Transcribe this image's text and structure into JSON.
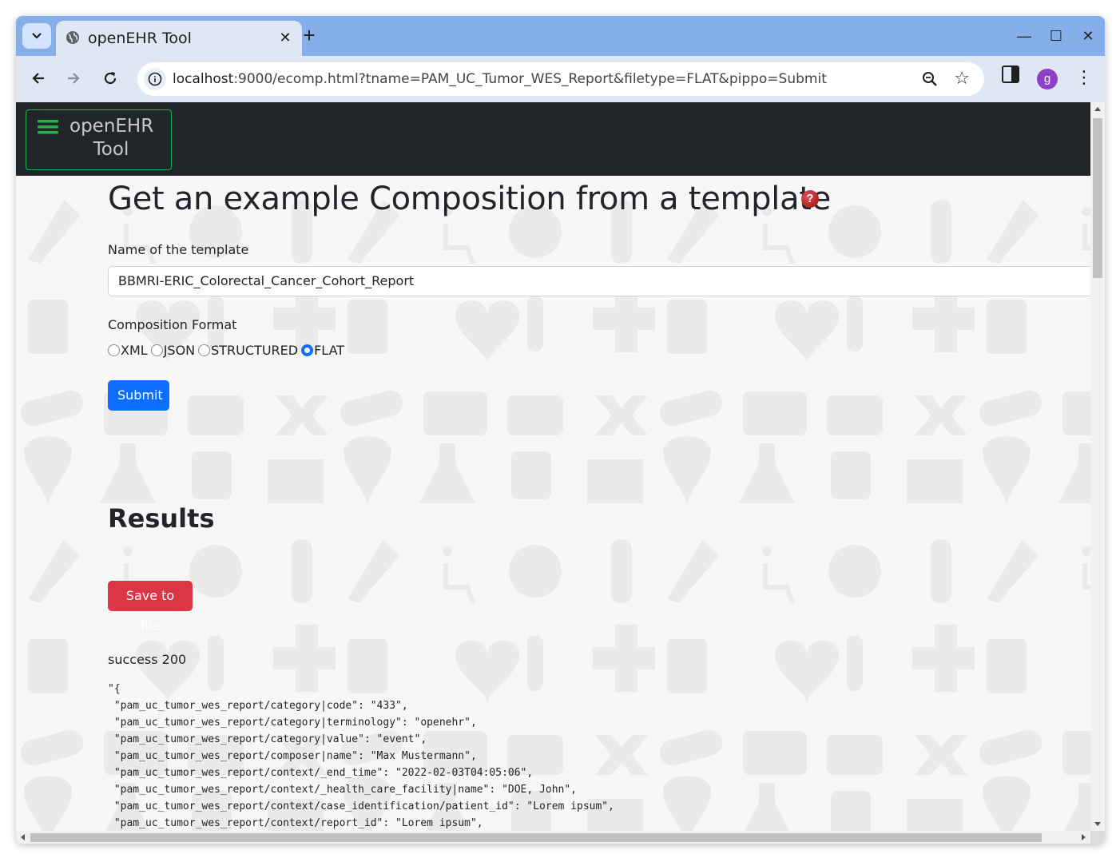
{
  "browser": {
    "tab_title": "openEHR Tool",
    "url_host": "localhost",
    "url_rest": ":9000/ecomp.html?tname=PAM_UC_Tumor_WES_Report&filetype=FLAT&pippo=Submit",
    "profile_initial": "g"
  },
  "navbar": {
    "brand_line1": "openEHR",
    "brand_line2": "Tool"
  },
  "page": {
    "title": "Get an example Composition from a template",
    "template_label": "Name of the template",
    "template_value": "BBMRI-ERIC_Colorectal_Cancer_Cohort_Report",
    "format_label": "Composition Format",
    "formats": [
      {
        "label": "XML",
        "checked": false
      },
      {
        "label": "JSON",
        "checked": false
      },
      {
        "label": "STRUCTURED",
        "checked": false
      },
      {
        "label": "FLAT",
        "checked": true
      }
    ],
    "submit_label": "Submit",
    "results_heading": "Results",
    "save_label": "Save to file",
    "status": "success 200",
    "output_lines": [
      "\"{",
      " \"pam_uc_tumor_wes_report/category|code\": \"433\",",
      " \"pam_uc_tumor_wes_report/category|terminology\": \"openehr\",",
      " \"pam_uc_tumor_wes_report/category|value\": \"event\",",
      " \"pam_uc_tumor_wes_report/composer|name\": \"Max Mustermann\",",
      " \"pam_uc_tumor_wes_report/context/_end_time\": \"2022-02-03T04:05:06\",",
      " \"pam_uc_tumor_wes_report/context/_health_care_facility|name\": \"DOE, John\",",
      " \"pam_uc_tumor_wes_report/context/case_identification/patient_id\": \"Lorem ipsum\",",
      " \"pam_uc_tumor_wes_report/context/report_id\": \"Lorem ipsum\","
    ]
  },
  "colors": {
    "navbar_bg": "#212529",
    "brand_border": "#27b148",
    "submit_bg": "#0d6efd",
    "save_bg": "#dc3545",
    "help_icon": "#b01c1c"
  }
}
